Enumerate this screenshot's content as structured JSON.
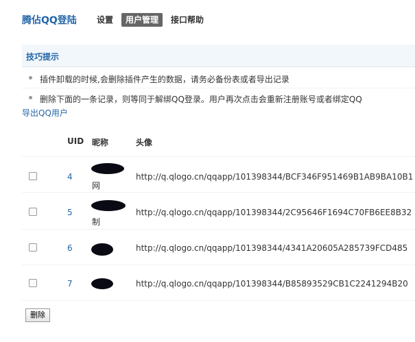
{
  "header": {
    "brand": "腾佔QQ登陆",
    "tabs": [
      {
        "label": "设置",
        "active": false
      },
      {
        "label": "用户管理",
        "active": true
      },
      {
        "label": "接口帮助",
        "active": false
      }
    ]
  },
  "tips": {
    "title": "技巧提示",
    "items": [
      "插件卸载的时候,会删除插件产生的数据，请务必备份表或者导出记录",
      "删除下面的一条记录，则等同于解绑QQ登录。用户再次点击会重新注册账号或者绑定QQ"
    ]
  },
  "export_link": "导出QQ用户",
  "table": {
    "headers": {
      "uid": "UID",
      "nickname": "昵称",
      "avatar": "头像"
    },
    "rows": [
      {
        "uid": "4",
        "nick_suffix": "网",
        "avatar": "http://q.qlogo.cn/qqapp/101398344/BCF346F951469B1AB9BA10B1"
      },
      {
        "uid": "5",
        "nick_suffix": "制",
        "avatar": "http://q.qlogo.cn/qqapp/101398344/2C95646F1694C70FB6EE8B32"
      },
      {
        "uid": "6",
        "nick_suffix": "",
        "avatar": "http://q.qlogo.cn/qqapp/101398344/4341A20605A285739FCD485"
      },
      {
        "uid": "7",
        "nick_suffix": "",
        "avatar": "http://q.qlogo.cn/qqapp/101398344/B85893529CB1C2241294B20"
      }
    ]
  },
  "delete_button": "删除",
  "colors": {
    "accent": "#2366a8",
    "active_tab_bg": "#666666",
    "tips_bg": "#f2f7fb"
  }
}
